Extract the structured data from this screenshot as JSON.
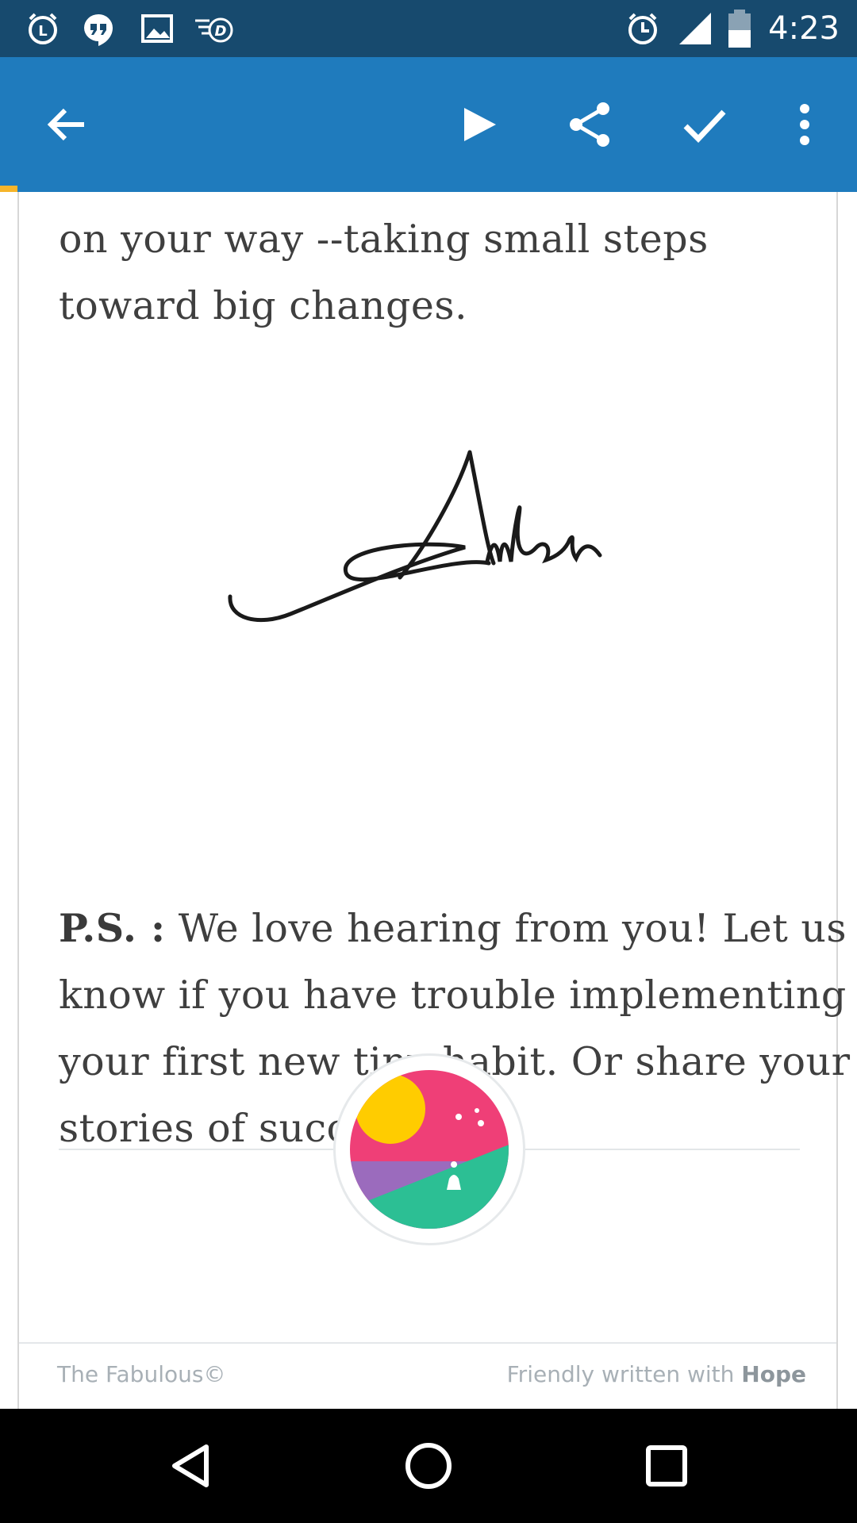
{
  "status_bar": {
    "time": "4:23",
    "left_icons": [
      "alarm-clock-icon",
      "hangouts-icon",
      "image-icon",
      "data-saver-icon"
    ],
    "right_icons": [
      "alarm-icon",
      "signal-icon",
      "battery-icon"
    ]
  },
  "toolbar": {
    "icons": [
      "back-arrow-icon",
      "play-icon",
      "share-icon",
      "check-icon",
      "more-vert-icon"
    ],
    "color": "#1f7bbd"
  },
  "content": {
    "paragraph_1": "on your way --taking small steps toward big changes.",
    "signature_text": "Amber",
    "ps_label": "P.S. :",
    "ps_text": " We love hearing from you! Let us know if you have trouble implementing your first new tiny habit. Or share your stories of success!"
  },
  "footer": {
    "left": "The Fabulous©",
    "right_prefix": "Friendly written with ",
    "right_bold": "Hope"
  },
  "colors": {
    "status_bar": "#174a6e",
    "accent": "#f6b52a",
    "logo_pink": "#ef3f77",
    "logo_yellow": "#ffcc00",
    "logo_purple": "#9b6bbd",
    "logo_green": "#2cbf94"
  },
  "nav_bar": {
    "icons": [
      "back-triangle-icon",
      "home-circle-icon",
      "recents-square-icon"
    ]
  }
}
